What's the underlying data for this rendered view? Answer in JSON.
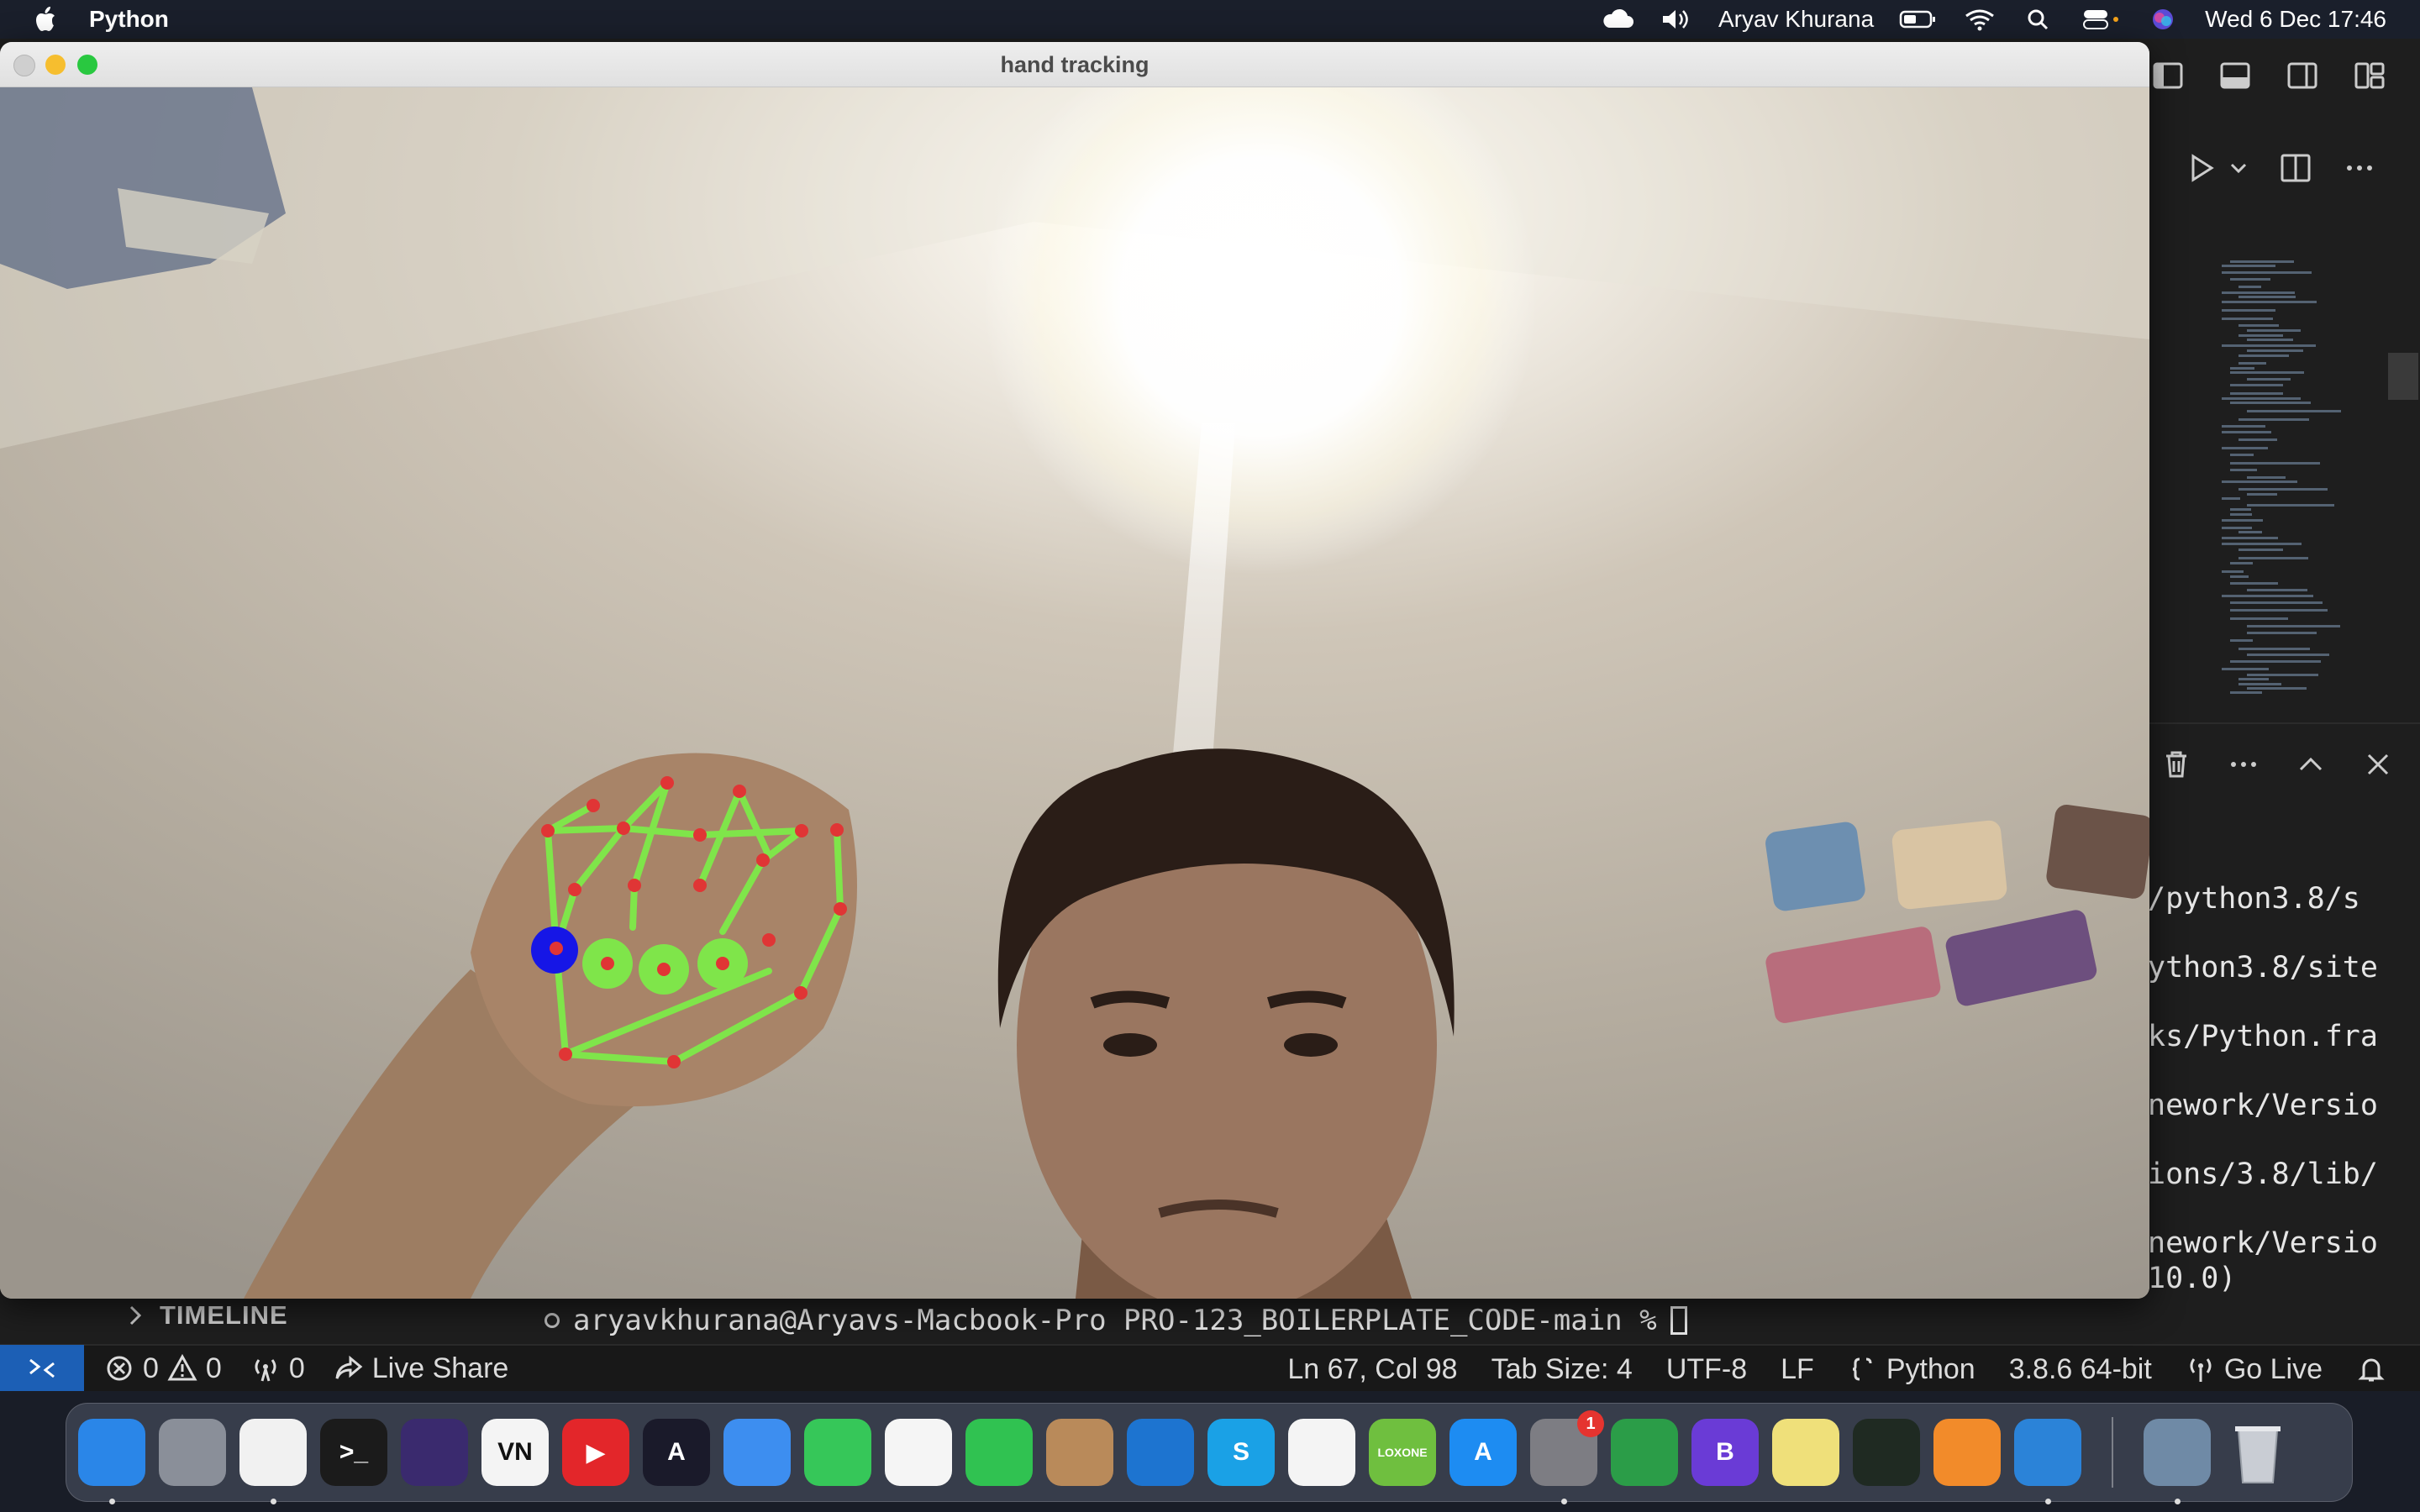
{
  "menubar": {
    "app_name": "Python",
    "user_name": "Aryav Khurana",
    "datetime": "Wed 6 Dec  17:46",
    "status_icons": [
      "icloud-icon",
      "volume-icon",
      "battery-icon",
      "wifi-icon",
      "spotlight-icon",
      "control-center-icon",
      "siri-icon"
    ]
  },
  "window": {
    "title": "hand tracking"
  },
  "timeline": {
    "label": "TIMELINE"
  },
  "terminal": {
    "prompt": "aryavkhurana@Aryavs-Macbook-Pro PRO-123_BOILERPLATE_CODE-main %",
    "partial_lines": [
      "/python3.8/s",
      "ython3.8/site",
      "ks/Python.fra",
      "nework/Versio",
      "ions/3.8/lib/",
      "nework/Versio",
      "10.0)"
    ]
  },
  "statusbar": {
    "errors": "0",
    "warnings": "0",
    "ports": "0",
    "live_share": "Live Share",
    "cursor_pos": "Ln 67, Col 98",
    "tab_size": "Tab Size: 4",
    "encoding": "UTF-8",
    "eol": "LF",
    "language": "Python",
    "interpreter": "3.8.6 64-bit",
    "go_live": "Go Live"
  },
  "dock": {
    "apps": [
      {
        "name": "finder",
        "label": "",
        "color": "#2a86e8"
      },
      {
        "name": "launchpad",
        "label": "",
        "color": "#8a8f99"
      },
      {
        "name": "chrome",
        "label": "",
        "color": "#f1f1f1"
      },
      {
        "name": "terminal",
        "label": ">_",
        "color": "#1b1b1b"
      },
      {
        "name": "siri",
        "label": "",
        "color": "#3a2a6e"
      },
      {
        "name": "vn",
        "label": "VN",
        "color": "#f4f4f4"
      },
      {
        "name": "youtube",
        "label": "▶",
        "color": "#e3262a"
      },
      {
        "name": "arc",
        "label": "A",
        "color": "#1a1a2a"
      },
      {
        "name": "safari",
        "label": "",
        "color": "#3d8ef0"
      },
      {
        "name": "messages",
        "label": "",
        "color": "#36c759"
      },
      {
        "name": "photos",
        "label": "",
        "color": "#f5f5f5"
      },
      {
        "name": "facetime",
        "label": "",
        "color": "#30c251"
      },
      {
        "name": "contacts",
        "label": "",
        "color": "#b98a5a"
      },
      {
        "name": "onedrive",
        "label": "",
        "color": "#1d74d0"
      },
      {
        "name": "skype",
        "label": "S",
        "color": "#1aa1e6"
      },
      {
        "name": "notes",
        "label": "",
        "color": "#f4f4f4"
      },
      {
        "name": "loxone",
        "label": "LOXONE",
        "color": "#6fbf3f"
      },
      {
        "name": "app-store",
        "label": "A",
        "color": "#1d8cf2"
      },
      {
        "name": "system-settings",
        "label": "",
        "color": "#7d7d83"
      },
      {
        "name": "classroom",
        "label": "",
        "color": "#2b9d48"
      },
      {
        "name": "bezel",
        "label": "B",
        "color": "#6a3bd6"
      },
      {
        "name": "stickies",
        "label": "",
        "color": "#efe07a"
      },
      {
        "name": "activity-monitor",
        "label": "",
        "color": "#1f2a22"
      },
      {
        "name": "stacks",
        "label": "",
        "color": "#f28b2a"
      },
      {
        "name": "vscode",
        "label": "",
        "color": "#2b83d8"
      },
      {
        "name": "rocket",
        "label": "",
        "color": "#6f8aa6"
      }
    ],
    "settings_badge": "1"
  }
}
